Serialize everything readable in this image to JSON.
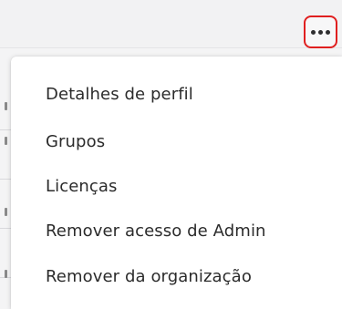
{
  "toolbar": {
    "more_icon": "more-horizontal-icon",
    "highlight_color": "#e01f1f"
  },
  "menu": {
    "items": [
      {
        "label": "Detalhes de perfil"
      },
      {
        "label": "Grupos"
      },
      {
        "label": "Licenças"
      },
      {
        "label": "Remover acesso de Admin"
      },
      {
        "label": "Remover da organização"
      }
    ]
  }
}
